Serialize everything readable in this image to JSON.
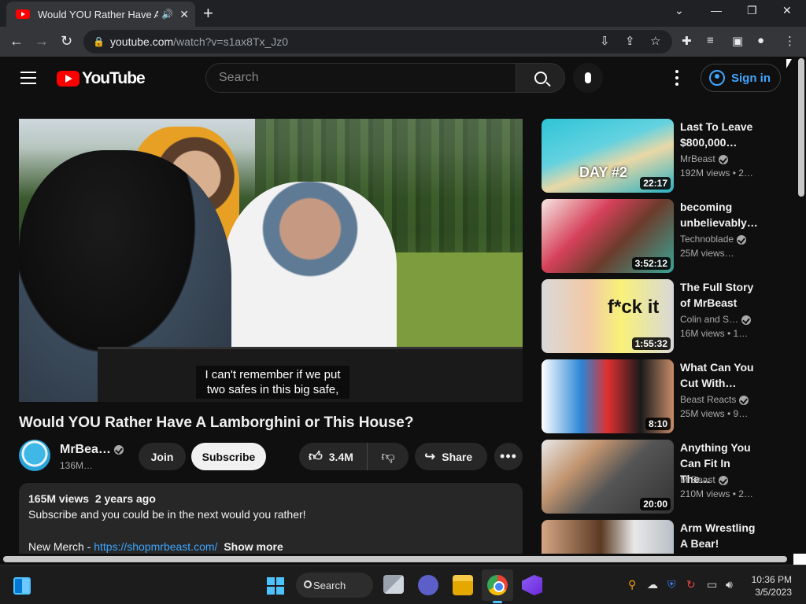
{
  "browser": {
    "tab_title": "Would YOU Rather Have A La",
    "url_domain": "youtube.com",
    "url_path": "/watch?v=s1ax8Tx_Jz0"
  },
  "header": {
    "logo_text": "YouTube",
    "search_placeholder": "Search",
    "signin_label": "Sign in"
  },
  "video": {
    "caption_line1": "I can't remember if we put",
    "caption_line2": "two safes in this big safe,",
    "title": "Would YOU Rather Have A Lamborghini or This House?",
    "channel": "MrBea…",
    "subscribers": "136M…",
    "join_label": "Join",
    "subscribe_label": "Subscribe",
    "likes": "3.4M",
    "share_label": "Share",
    "more_label": "•••"
  },
  "description": {
    "views": "165M views",
    "age": "2 years ago",
    "line1": "Subscribe and you could be in the next would you rather!",
    "merch_prefix": "New Merch - ",
    "merch_link": "https://shopmrbeast.com/",
    "show_more": "Show more"
  },
  "recommendations": [
    {
      "title": "Last To Leave $800,000…",
      "channel": "MrBeast",
      "views": "192M views  • 2…",
      "duration": "22:17",
      "overlay": "DAY #2"
    },
    {
      "title": "becoming unbelievably…",
      "channel": "Technoblade",
      "views": "25M views…",
      "duration": "3:52:12",
      "overlay": ""
    },
    {
      "title": "The Full Story of MrBeast",
      "channel": "Colin and S…",
      "views": "16M views  • 1…",
      "duration": "1:55:32",
      "overlay": "f*ck it"
    },
    {
      "title": "What Can You Cut With…",
      "channel": "Beast Reacts",
      "views": "25M views  • 9…",
      "duration": "8:10",
      "overlay": ""
    },
    {
      "title": "Anything You Can Fit In The…",
      "channel": "MrBeast",
      "views": "210M views  • 2…",
      "duration": "20:00",
      "overlay": ""
    },
    {
      "title": "Arm Wrestling A Bear!",
      "channel": "",
      "views": "",
      "duration": "",
      "overlay": ""
    }
  ],
  "taskbar": {
    "search_label": "Search",
    "time": "10:36 PM",
    "date": "3/5/2023"
  },
  "colors": {
    "accent_blue": "#3ea6ff",
    "youtube_red": "#ff0000",
    "background": "#0f0f0f"
  }
}
